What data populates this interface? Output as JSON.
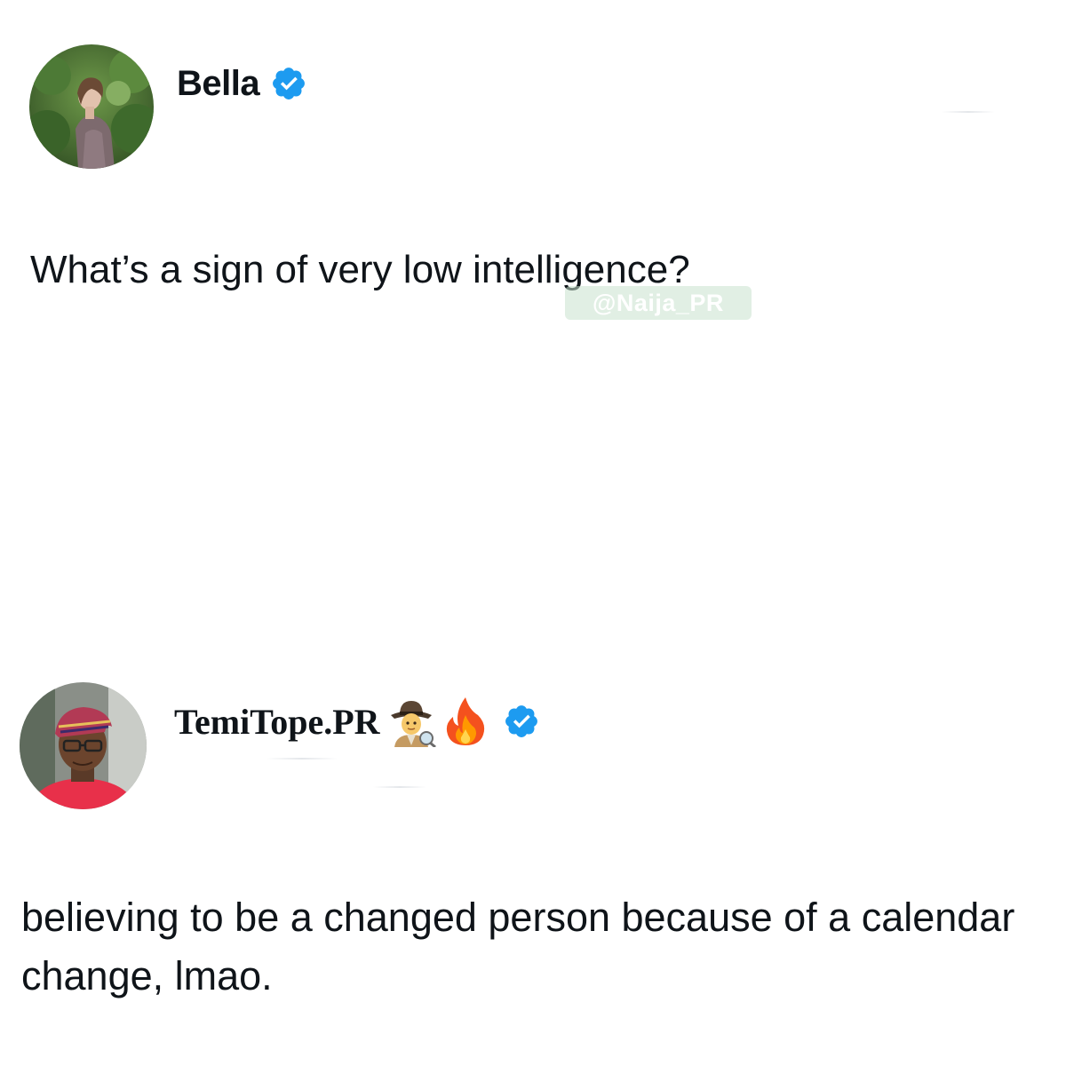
{
  "posts": [
    {
      "author": "Bella",
      "verified": true,
      "text": "What’s a sign of very low intelligence?"
    },
    {
      "author": "TemiTope.PR",
      "name_emojis": [
        "detective-emoji",
        "fire-emoji"
      ],
      "verified": true,
      "text": "believing to be a changed person because of a calendar change, lmao."
    }
  ],
  "watermark": "@Naija_PR",
  "colors": {
    "verified_badge": "#1d9bf0",
    "text": "#0f1419",
    "background": "#ffffff"
  }
}
